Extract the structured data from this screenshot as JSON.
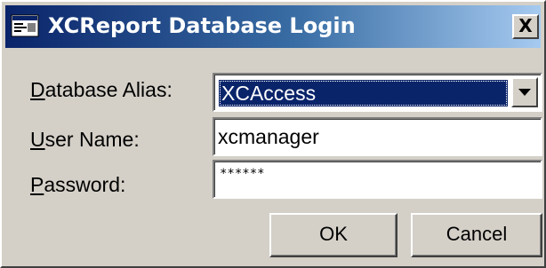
{
  "window": {
    "title": "XCReport Database Login",
    "close_glyph": "X",
    "title_icon": "app-window-icon"
  },
  "form": {
    "alias_label_mnemonic": "D",
    "alias_label_rest": "atabase Alias:",
    "alias_value": "XCAccess",
    "user_label_mnemonic": "U",
    "user_label_rest": "ser Name:",
    "user_value": "xcmanager",
    "password_label_mnemonic": "P",
    "password_label_rest": "assword:",
    "password_masked": "******"
  },
  "buttons": {
    "ok_label": "OK",
    "cancel_label": "Cancel"
  },
  "colors": {
    "title_start": "#0a246a",
    "title_end": "#a6caf0",
    "face": "#d4d0c8",
    "selection": "#0a246a"
  }
}
